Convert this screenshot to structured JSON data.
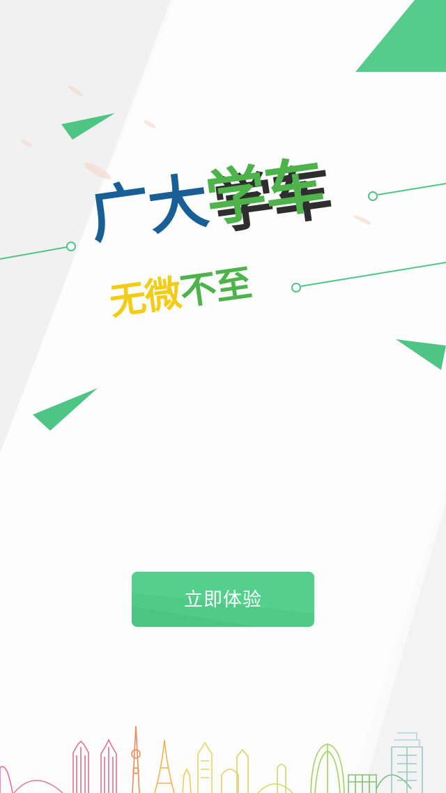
{
  "logo": {
    "line1": [
      "广",
      "大",
      "学",
      "车"
    ],
    "line2": [
      "无",
      "微",
      "不",
      "至"
    ]
  },
  "cta": {
    "label": "立即体验"
  },
  "colors": {
    "brand_green": "#55cf8c",
    "logo_blue": "#1a5e96",
    "logo_green": "#4db34a",
    "logo_yellow": "#f3cc16",
    "background": "#fafafa"
  }
}
